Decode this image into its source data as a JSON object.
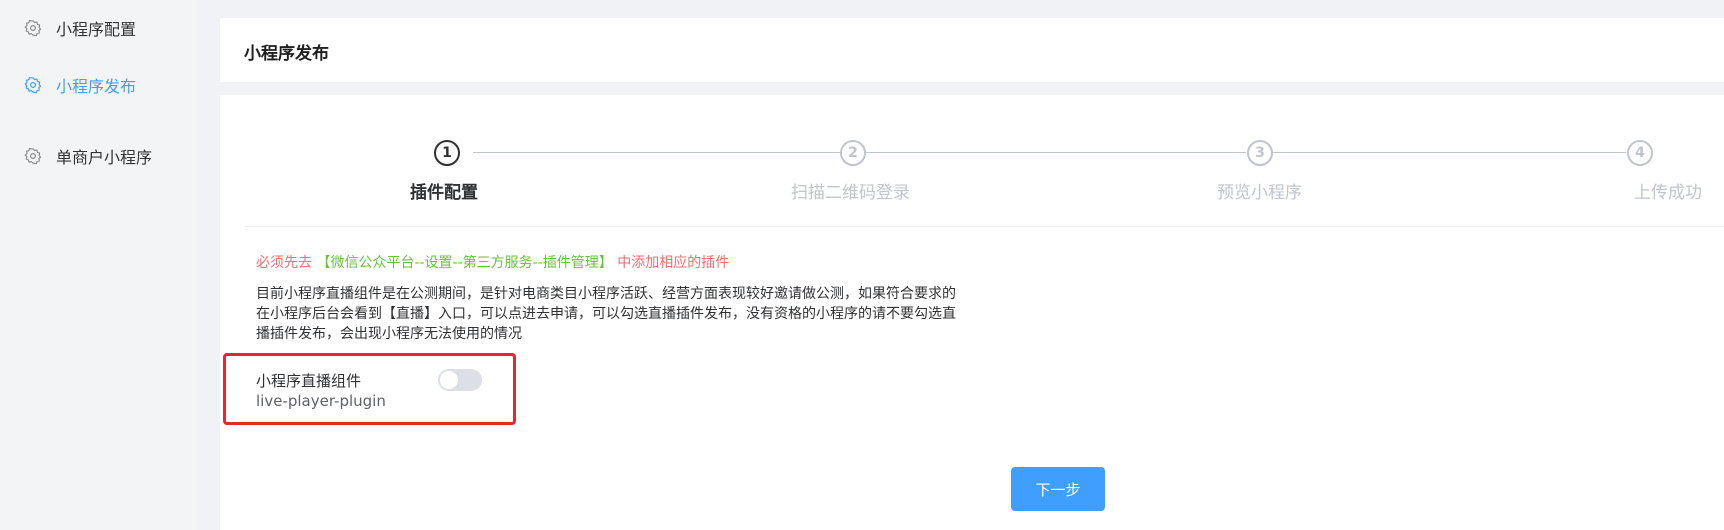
{
  "sidebar": {
    "items": [
      {
        "label": "小程序配置",
        "icon": "gear-icon",
        "active": false
      },
      {
        "label": "小程序发布",
        "icon": "gear-icon",
        "active": true
      },
      {
        "label": "单商户小程序",
        "icon": "gear-icon",
        "active": false
      }
    ]
  },
  "header": {
    "title": "小程序发布"
  },
  "steps": [
    {
      "number": "1",
      "title": "插件配置",
      "active": true
    },
    {
      "number": "2",
      "title": "扫描二维码登录",
      "active": false
    },
    {
      "number": "3",
      "title": "预览小程序",
      "active": false
    },
    {
      "number": "4",
      "title": "上传成功",
      "active": false
    }
  ],
  "notice": {
    "prefix": "必须先去",
    "path": "【微信公众平台--设置--第三方服务--插件管理】",
    "suffix": "中添加相应的插件"
  },
  "description": "目前小程序直播组件是在公测期间，是针对电商类目小程序活跃、经营方面表现较好邀请做公测，如果符合要求的在小程序后台会看到【直播】入口，可以点进去申请，可以勾选直播插件发布，没有资格的小程序的请不要勾选直播插件发布，会出现小程序无法使用的情况",
  "plugin": {
    "name": "小程序直播组件",
    "id": "live-player-plugin",
    "enabled": false
  },
  "actions": {
    "next_label": "下一步"
  },
  "colors": {
    "accent": "#409eff",
    "warning": "#f56c6c",
    "success": "#67c23a",
    "highlight_box": "#e8262c"
  }
}
